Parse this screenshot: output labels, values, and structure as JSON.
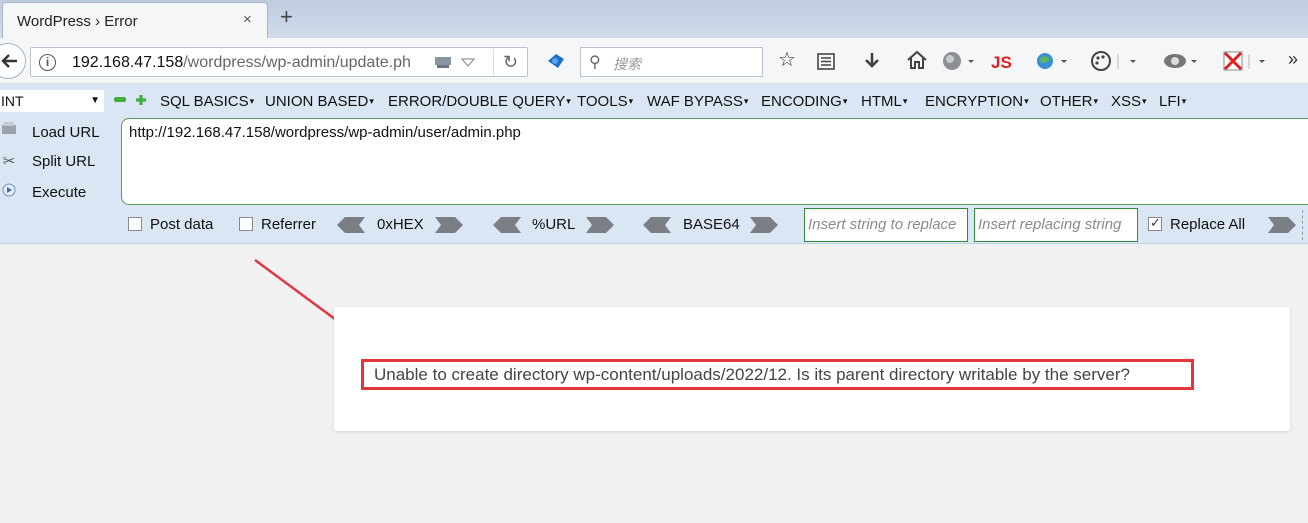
{
  "tab": {
    "title": "WordPress › Error",
    "close": "×",
    "new_tab": "+"
  },
  "navbar": {
    "url_host": "192.168.47.158",
    "url_path": "/wordpress/wp-admin/update.ph",
    "search_placeholder": "搜索",
    "js_label": "JS"
  },
  "hackbar": {
    "select_value": "INT",
    "menu": [
      "SQL BASICS",
      "UNION BASED",
      "ERROR/DOUBLE QUERY",
      "TOOLS",
      "WAF BYPASS",
      "ENCODING",
      "HTML",
      "ENCRYPTION",
      "OTHER",
      "XSS",
      "LFI"
    ],
    "side_buttons": [
      "Load URL",
      "Split URL",
      "Execute"
    ],
    "url_value": "http://192.168.47.158/wordpress/wp-admin/user/admin.php",
    "post_data": "Post data",
    "referrer": "Referrer",
    "hex": "0xHEX",
    "url_enc": "%URL",
    "base64": "BASE64",
    "find_placeholder": "Insert string to replace",
    "replace_placeholder": "Insert replacing string",
    "replace_all": "Replace All",
    "replace_all_checked": true
  },
  "content": {
    "error_message": "Unable to create directory wp-content/uploads/2022/12. Is its parent directory writable by the server?"
  },
  "colors": {
    "annotation": "#e0363c",
    "hackbar_bg": "#dbe6f4"
  }
}
